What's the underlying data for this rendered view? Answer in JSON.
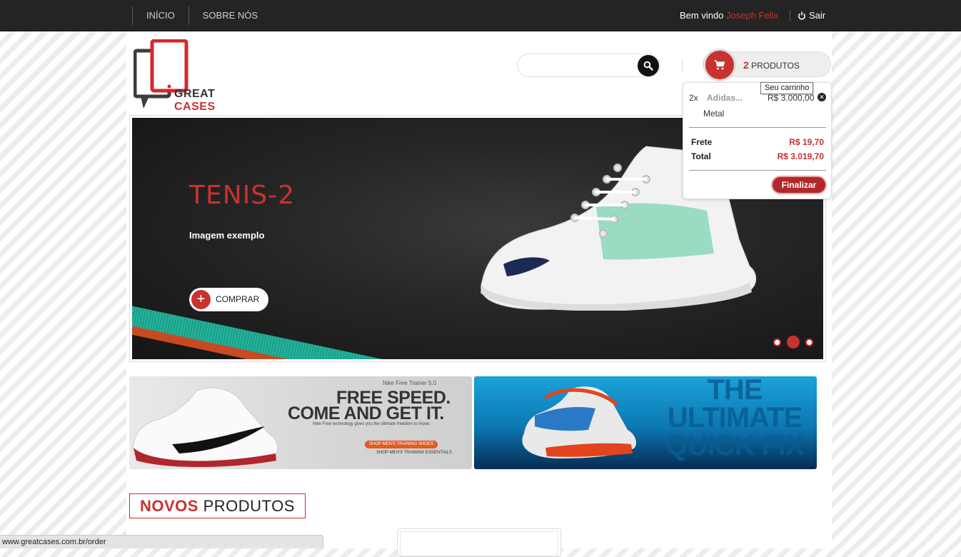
{
  "topbar": {
    "nav": [
      "INÍCIO",
      "SOBRE NÓS"
    ],
    "welcome_label": "Bem vindo",
    "user_name": "Joseph Felix",
    "logout_label": "Sair"
  },
  "brand": {
    "name_part1": "GREAT",
    "name_part2": "CASES"
  },
  "search": {
    "value": "",
    "placeholder": ""
  },
  "cart": {
    "count": "2",
    "label": "PRODUTOS",
    "tooltip": "Seu carrinho",
    "items": [
      {
        "qty": "2x",
        "name": "Adidas...",
        "price": "R$ 3.000,00",
        "variant": "Metal"
      }
    ],
    "shipping_label": "Frete",
    "shipping_value": "R$ 19,70",
    "total_label": "Total",
    "total_value": "R$ 3.019,70",
    "finalize_label": "Finalizar"
  },
  "slider": {
    "title": "TENIS-2",
    "subtitle": "Imagem exemplo",
    "button_label": "COMPRAR",
    "slides": 3,
    "active_slide": 2
  },
  "banners": {
    "left": {
      "small": "Nike Free Trainer 5.0",
      "headline1": "FREE SPEED.",
      "headline2": "COME AND GET IT.",
      "description": "Nike Free technology gives you the ultimate freedom to move.",
      "cta1": "SHOP MEN'S TRAINING SHOES",
      "cta2": "SHOP MEN'S TRAINING ESSENTIALS"
    },
    "right": {
      "headline": "THE ULTIMATE QUICK FIX"
    }
  },
  "section": {
    "title_bold": "NOVOS",
    "title_rest": "PRODUTOS"
  },
  "statusbar": {
    "url": "www.greatcases.com.br/order"
  },
  "colors": {
    "accent": "#c8322f",
    "topbar": "#242424"
  }
}
